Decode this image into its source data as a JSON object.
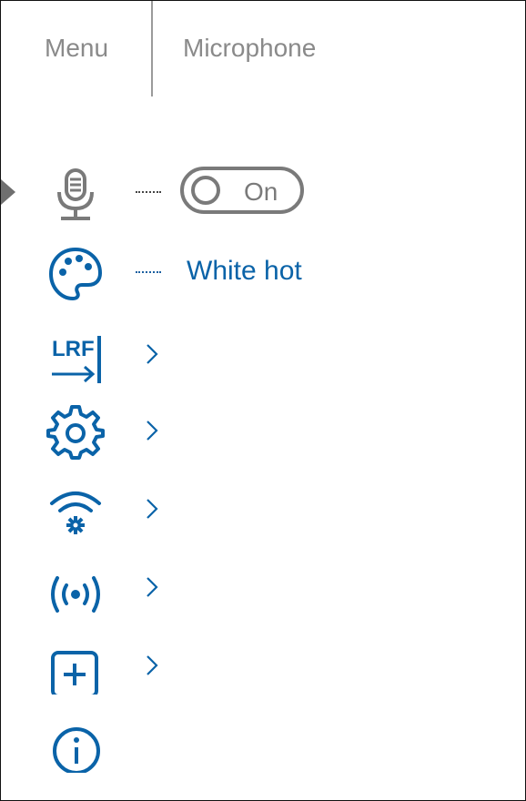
{
  "header": {
    "menu_label": "Menu",
    "title": "Microphone"
  },
  "colors": {
    "accent": "#0A63A8",
    "inactive": "#7A7A7A",
    "header_text": "#8A8A8A"
  },
  "menu": {
    "selected_index": 0,
    "items": [
      {
        "icon": "microphone-icon",
        "control": "toggle",
        "toggle_label": "On",
        "toggle_state": "on"
      },
      {
        "icon": "palette-icon",
        "control": "value",
        "value": "White hot"
      },
      {
        "icon": "lrf-icon",
        "icon_text": "LRF",
        "control": "submenu"
      },
      {
        "icon": "gear-icon",
        "control": "submenu"
      },
      {
        "icon": "wifi-settings-icon",
        "control": "submenu"
      },
      {
        "icon": "broadcast-icon",
        "control": "submenu"
      },
      {
        "icon": "plus-box-icon",
        "control": "submenu"
      },
      {
        "icon": "info-icon",
        "control": "none"
      }
    ]
  }
}
